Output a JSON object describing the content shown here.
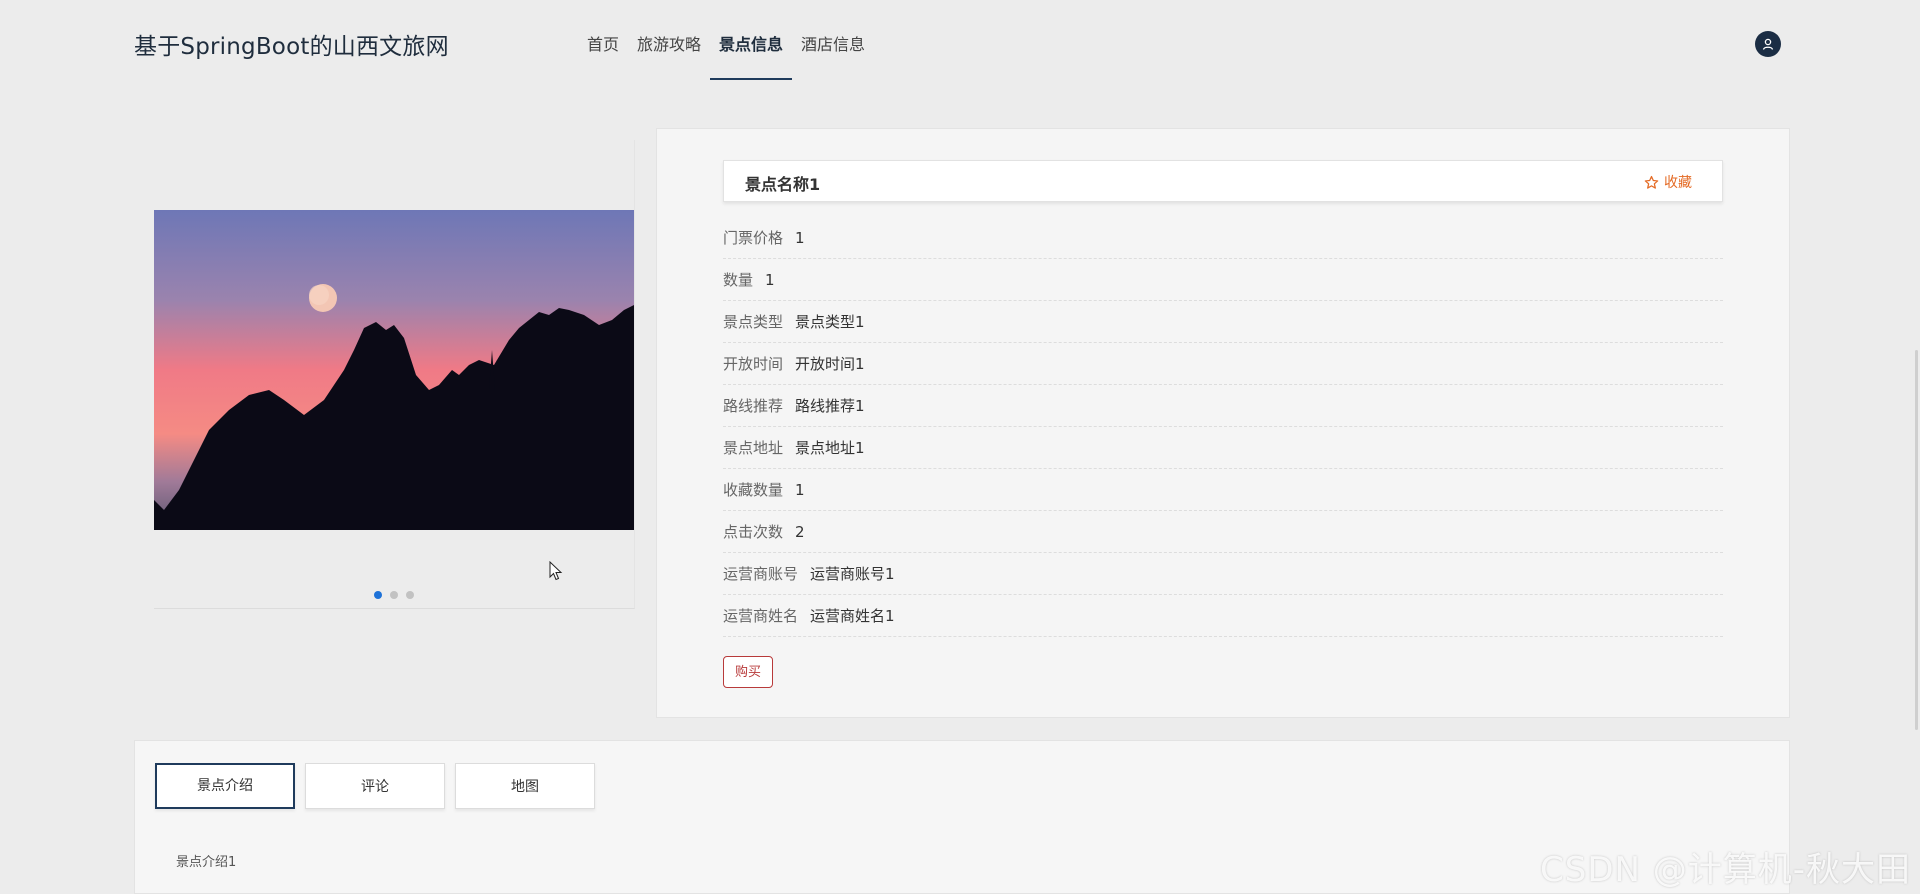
{
  "header": {
    "site_title": "基于SpringBoot的山西文旅网",
    "nav": [
      {
        "label": "首页"
      },
      {
        "label": "旅游攻略"
      },
      {
        "label": "景点信息"
      },
      {
        "label": "酒店信息"
      }
    ],
    "active_nav": "景点信息",
    "user_icon": "user-icon"
  },
  "carousel": {
    "image_icon": "mountain-sunset-photo",
    "active_index": 0,
    "dot_count": 3
  },
  "detail": {
    "spot_name": "景点名称1",
    "favorite_label": "收藏",
    "favorite_icon": "star-icon",
    "fields": [
      {
        "label": "门票价格",
        "value": "1"
      },
      {
        "label": "数量",
        "value": "1"
      },
      {
        "label": "景点类型",
        "value": "景点类型1"
      },
      {
        "label": "开放时间",
        "value": "开放时间1"
      },
      {
        "label": "路线推荐",
        "value": "路线推荐1"
      },
      {
        "label": "景点地址",
        "value": "景点地址1"
      },
      {
        "label": "收藏数量",
        "value": "1"
      },
      {
        "label": "点击次数",
        "value": "2"
      },
      {
        "label": "运营商账号",
        "value": "运营商账号1"
      },
      {
        "label": "运营商姓名",
        "value": "运营商姓名1"
      }
    ],
    "buy_label": "购买"
  },
  "tabs": {
    "items": [
      {
        "label": "景点介绍"
      },
      {
        "label": "评论"
      },
      {
        "label": "地图"
      }
    ],
    "active": "景点介绍",
    "content": "景点介绍1"
  },
  "watermark": "CSDN @计算机-秋大田",
  "colors": {
    "accent": "#1f3b5c",
    "favorite": "#e46a24",
    "buy": "#b83a3a",
    "dot_active": "#1e72d8"
  }
}
